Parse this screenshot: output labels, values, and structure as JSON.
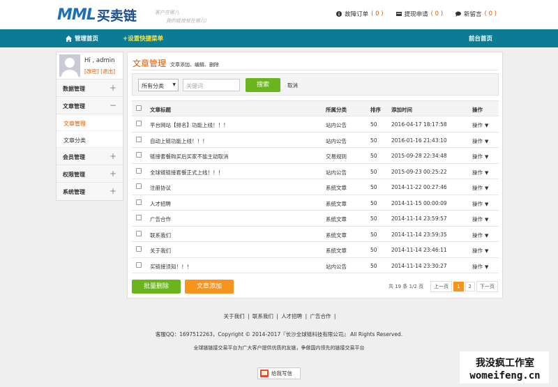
{
  "brand": {
    "logo_latin": "MML",
    "logo_cn": "买卖链",
    "slogan_line1": "客户在哪儿",
    "slogan_line2": "我的链接就在哪儿!"
  },
  "top_links": [
    {
      "label": "故障订单",
      "count": "( 0 )",
      "icon": "info-icon"
    },
    {
      "label": "提现申请",
      "count": "( 0 )",
      "icon": "card-icon"
    },
    {
      "label": "新留言",
      "count": "( 0 )",
      "icon": "chat-icon"
    }
  ],
  "nav": {
    "home": "管理首页",
    "quick": "+设置快捷菜单",
    "front": "前台首页"
  },
  "user": {
    "hi": "Hi , admin",
    "change_pwd": "[改密]",
    "logout": "[退出]"
  },
  "sidebar": {
    "data_mgmt": "数据管理",
    "article_mgmt": "文章管理",
    "article_sub1": "文章管理",
    "article_sub2": "文章分类",
    "member_mgmt": "会员管理",
    "perm_mgmt": "权限管理",
    "system_mgmt": "系统管理"
  },
  "main": {
    "title": "文章管理",
    "subtitle": "文章添加、编辑、删除"
  },
  "search": {
    "category_selected": "所有分类",
    "keyword_placeholder": "关键词",
    "search_button": "搜索",
    "cancel": "取消"
  },
  "table": {
    "headers": {
      "title": "文章标题",
      "category": "所属分类",
      "sort": "排序",
      "time": "添加时间",
      "op": "操作"
    },
    "rows": [
      {
        "title": "平台网站【排名】功能上线！！！",
        "category": "站内公告",
        "sort": "50",
        "time": "2016-04-17 18:17:58",
        "op": "操作"
      },
      {
        "title": "自动上链功能上线！！！",
        "category": "站内公告",
        "sort": "50",
        "time": "2016-01-16 21:43:10",
        "op": "操作"
      },
      {
        "title": "链接套餐购买后买家不能主动取消",
        "category": "交易规则",
        "sort": "50",
        "time": "2015-09-28 22:34:48",
        "op": "操作"
      },
      {
        "title": "全球链链接套餐正式上线！！！",
        "category": "站内公告",
        "sort": "50",
        "time": "2015-09-23 00:25:22",
        "op": "操作"
      },
      {
        "title": "注册协议",
        "category": "系统文章",
        "sort": "50",
        "time": "2014-11-22 00:27:46",
        "op": "操作"
      },
      {
        "title": "人才招聘",
        "category": "系统文章",
        "sort": "50",
        "time": "2014-11-15 00:00:09",
        "op": "操作"
      },
      {
        "title": "广告合作",
        "category": "系统文章",
        "sort": "50",
        "time": "2014-11-14 23:59:57",
        "op": "操作"
      },
      {
        "title": "联系我们",
        "category": "系统文章",
        "sort": "50",
        "time": "2014-11-14 23:59:35",
        "op": "操作"
      },
      {
        "title": "关于我们",
        "category": "系统文章",
        "sort": "50",
        "time": "2014-11-14 23:46:11",
        "op": "操作"
      },
      {
        "title": "买链接须知！！！",
        "category": "站内公告",
        "sort": "50",
        "time": "2014-11-14 23:30:27",
        "op": "操作"
      }
    ]
  },
  "actions": {
    "batch_delete": "批量删除",
    "add_article": "文章添加"
  },
  "pager": {
    "info": "共 19 条 1/2 页",
    "prev": "上一页",
    "page1": "1",
    "page2": "2",
    "next": "下一页"
  },
  "footer": {
    "links": [
      "关于我们",
      "联系我们",
      "人才招聘",
      "广告合作"
    ],
    "copyright": "客服QQ：1697512263，Copyright © 2014-2017『长沙全球链科技有限公司』 All Rights Reserved.",
    "slogan": "全球链链接交易平台为广大客户提供优质的友链，争做国内领先的链接交易平台",
    "mailbox": "给我写信"
  },
  "watermark": {
    "line1": "我没疯工作室",
    "line2": "womeifeng.cn"
  },
  "colors": {
    "nav": "#0c7c94",
    "accent": "#e05a00",
    "green": "#6ab51e",
    "orange": "#f7941d"
  }
}
